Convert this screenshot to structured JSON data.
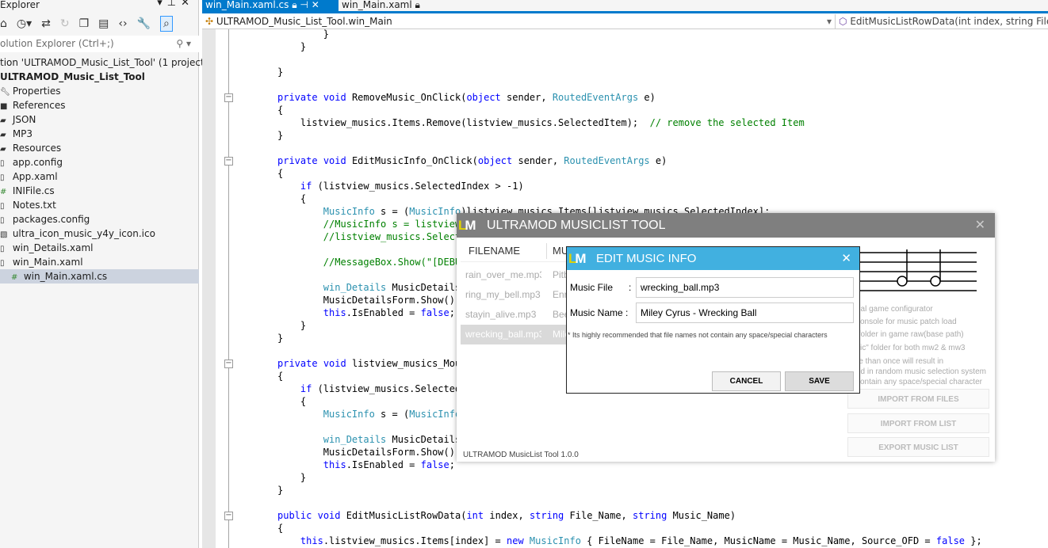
{
  "solution_explorer": {
    "title": "Explorer",
    "search_placeholder": "olution Explorer (Ctrl+;)",
    "items": [
      {
        "label": "tion 'ULTRAMOD_Music_List_Tool' (1 project)",
        "icon": "solution-icon",
        "indent": 0,
        "bold": false
      },
      {
        "label": "ULTRAMOD_Music_List_Tool",
        "icon": "project-icon",
        "indent": 0,
        "bold": true
      },
      {
        "label": "Properties",
        "icon": "wrench-icon",
        "indent": 1
      },
      {
        "label": "References",
        "icon": "references-icon",
        "indent": 1
      },
      {
        "label": "JSON",
        "icon": "folder-icon",
        "indent": 1
      },
      {
        "label": "MP3",
        "icon": "folder-icon",
        "indent": 1
      },
      {
        "label": "Resources",
        "icon": "folder-icon",
        "indent": 1
      },
      {
        "label": "app.config",
        "icon": "file-icon",
        "indent": 1
      },
      {
        "label": "App.xaml",
        "icon": "xaml-file-icon",
        "indent": 1
      },
      {
        "label": "INIFile.cs",
        "icon": "csharp-file-icon",
        "indent": 1
      },
      {
        "label": "Notes.txt",
        "icon": "file-icon",
        "indent": 1
      },
      {
        "label": "packages.config",
        "icon": "file-icon",
        "indent": 1
      },
      {
        "label": "ultra_icon_music_y4y_icon.ico",
        "icon": "image-file-icon",
        "indent": 1
      },
      {
        "label": "win_Details.xaml",
        "icon": "xaml-file-icon",
        "indent": 1
      },
      {
        "label": "win_Main.xaml",
        "icon": "xaml-file-icon",
        "indent": 1
      },
      {
        "label": "win_Main.xaml.cs",
        "icon": "csharp-file-icon",
        "indent": 2,
        "selected": true
      }
    ]
  },
  "tabs": [
    {
      "label": "win_Main.xaml.cs",
      "active": true
    },
    {
      "label": "win_Main.xaml",
      "active": false
    }
  ],
  "nav": {
    "class_selector": "ULTRAMOD_Music_List_Tool.win_Main",
    "member_selector": "EditMusicListRowData(int index, string File_Name, string Music_Name)"
  },
  "code_lines": [
    [
      [
        "        }",
        "p"
      ]
    ],
    [
      [
        "    }",
        "p"
      ]
    ],
    [],
    [
      [
        "}",
        "p"
      ]
    ],
    [],
    [
      [
        "private",
        "k"
      ],
      [
        " ",
        "p"
      ],
      [
        "void",
        "k"
      ],
      [
        " RemoveMusic_OnClick(",
        "p"
      ],
      [
        "object",
        "k"
      ],
      [
        " sender, ",
        "p"
      ],
      [
        "RoutedEventArgs",
        "t"
      ],
      [
        " e)",
        "p"
      ]
    ],
    [
      [
        "{",
        "p"
      ]
    ],
    [
      [
        "    listview_musics.Items.Remove(listview_musics.SelectedItem);  ",
        "p"
      ],
      [
        "// remove the selected Item",
        "c"
      ]
    ],
    [
      [
        "}",
        "p"
      ]
    ],
    [],
    [
      [
        "private",
        "k"
      ],
      [
        " ",
        "p"
      ],
      [
        "void",
        "k"
      ],
      [
        " EditMusicInfo_OnClick(",
        "p"
      ],
      [
        "object",
        "k"
      ],
      [
        " sender, ",
        "p"
      ],
      [
        "RoutedEventArgs",
        "t"
      ],
      [
        " e)",
        "p"
      ]
    ],
    [
      [
        "{",
        "p"
      ]
    ],
    [
      [
        "    ",
        "p"
      ],
      [
        "if",
        "k"
      ],
      [
        " (listview_musics.SelectedIndex > -1)",
        "p"
      ]
    ],
    [
      [
        "    {",
        "p"
      ]
    ],
    [
      [
        "        ",
        "p"
      ],
      [
        "MusicInfo",
        "t"
      ],
      [
        " s = (",
        "p"
      ],
      [
        "MusicInfo",
        "t"
      ],
      [
        ")listview_musics.Items[listview_musics.SelectedIndex];",
        "p"
      ]
    ],
    [
      [
        "        //MusicInfo s = listview_",
        "c"
      ]
    ],
    [
      [
        "        //listview_musics.Selecte",
        "c"
      ]
    ],
    [],
    [
      [
        "        //MessageBox.Show(\"[DEBU",
        "c"
      ]
    ],
    [],
    [
      [
        "        ",
        "p"
      ],
      [
        "win_Details",
        "t"
      ],
      [
        " MusicDetailsF",
        "p"
      ]
    ],
    [
      [
        "        MusicDetailsForm.Show();",
        "p"
      ]
    ],
    [
      [
        "        ",
        "p"
      ],
      [
        "this",
        "k"
      ],
      [
        ".IsEnabled = ",
        "p"
      ],
      [
        "false",
        "k"
      ],
      [
        ";",
        "p"
      ]
    ],
    [
      [
        "    }",
        "p"
      ]
    ],
    [
      [
        "}",
        "p"
      ]
    ],
    [],
    [
      [
        "private",
        "k"
      ],
      [
        " ",
        "p"
      ],
      [
        "void",
        "k"
      ],
      [
        " listview_musics_Mous",
        "p"
      ]
    ],
    [
      [
        "{",
        "p"
      ]
    ],
    [
      [
        "    ",
        "p"
      ],
      [
        "if",
        "k"
      ],
      [
        " (listview_musics.SelectedI",
        "p"
      ]
    ],
    [
      [
        "    {",
        "p"
      ]
    ],
    [
      [
        "        ",
        "p"
      ],
      [
        "MusicInfo",
        "t"
      ],
      [
        " s = (",
        "p"
      ],
      [
        "MusicInfo",
        "t"
      ]
    ],
    [],
    [
      [
        "        ",
        "p"
      ],
      [
        "win_Details",
        "t"
      ],
      [
        " MusicDetailsF",
        "p"
      ]
    ],
    [
      [
        "        MusicDetailsForm.Show();",
        "p"
      ]
    ],
    [
      [
        "        ",
        "p"
      ],
      [
        "this",
        "k"
      ],
      [
        ".IsEnabled = ",
        "p"
      ],
      [
        "false",
        "k"
      ],
      [
        ";",
        "p"
      ]
    ],
    [
      [
        "    }",
        "p"
      ]
    ],
    [
      [
        "}",
        "p"
      ]
    ],
    [],
    [
      [
        "public",
        "k"
      ],
      [
        " ",
        "p"
      ],
      [
        "void",
        "k"
      ],
      [
        " EditMusicListRowData(",
        "p"
      ],
      [
        "int",
        "k"
      ],
      [
        " index, ",
        "p"
      ],
      [
        "string",
        "k"
      ],
      [
        " File_Name, ",
        "p"
      ],
      [
        "string",
        "k"
      ],
      [
        " Music_Name)",
        "p"
      ]
    ],
    [
      [
        "{",
        "p"
      ]
    ],
    [
      [
        "    ",
        "p"
      ],
      [
        "this",
        "k"
      ],
      [
        ".listview_musics.Items[index] = ",
        "p"
      ],
      [
        "new",
        "k"
      ],
      [
        " ",
        "p"
      ],
      [
        "MusicInfo",
        "t"
      ],
      [
        " { FileName = File_Name, MusicName = Music_Name, Source_OFD = ",
        "p"
      ],
      [
        "false",
        "k"
      ],
      [
        " };",
        "p"
      ]
    ]
  ],
  "main_window": {
    "title": "ULTRAMOD MUSICLIST TOOL",
    "logo": "LM",
    "columns": [
      "FILENAME",
      "MU"
    ],
    "rows": [
      {
        "file": "rain_over_me.mp3",
        "name": "Pitb"
      },
      {
        "file": "ring_my_bell.mp3",
        "name": "Enri"
      },
      {
        "file": "stayin_alive.mp3",
        "name": "Bee"
      },
      {
        "file": "wrecking_ball.mp3",
        "name": "Mile",
        "selected": true
      }
    ],
    "info_lines": [
      "nal game configurator",
      "console for music patch load",
      " folder in game raw(base path)",
      "sic\" folder for both mw2 & mw3",
      "re than once will result in",
      "ed in random music selection system",
      "contain any space/special character"
    ],
    "buttons": [
      "IMPORT FROM FILES",
      "IMPORT FROM LIST",
      "EXPORT MUSIC LIST"
    ],
    "version": "ULTRAMOD MusicList Tool 1.0.0",
    "close": "✕"
  },
  "edit_dialog": {
    "title": "EDIT MUSIC INFO",
    "logo": "LM",
    "close": "✕",
    "music_file_label": "Music File      :",
    "music_file_value": "wrecking_ball.mp3",
    "music_name_label": "Music Name :",
    "music_name_value": "Miley Cyrus - Wrecking Ball",
    "note": "* Its highly recommended that file names not contain any space/special characters",
    "cancel": "CANCEL",
    "save": "SAVE"
  },
  "colors": {
    "accent": "#007acc",
    "dialog_title": "#41b0e0",
    "main_title": "#7f7f7f",
    "keyword": "#0000ff",
    "type": "#2b91af",
    "comment": "#008000"
  }
}
